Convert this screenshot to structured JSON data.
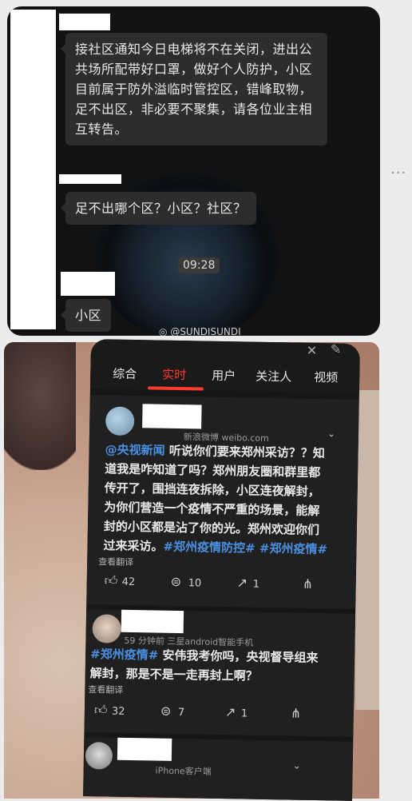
{
  "chat": {
    "message1": "接社区通知今日电梯将不在关闭，进出公共场所配带好口罩，做好个人防护，小区目前属于防外溢临时管控区，错峰取物，足不出区，非必要不聚集，请各位业主相互转告。",
    "message2": "足不出哪个区？小区？社区？",
    "timestamp": "09:28",
    "message3": "小区",
    "watermark": "@SUNDISUNDI",
    "more_icon": "···"
  },
  "weibo": {
    "tabs": [
      "综合",
      "实时",
      "用户",
      "关注人",
      "视频"
    ],
    "active_tab": "实时",
    "post1": {
      "source": "新浪微博 weibo.com",
      "mention": "@央视新闻",
      "text": " 听说你们要来郑州采访？？知道我是咋知道了吗？郑州朋友圈和群里都传开了，围挡连夜拆除，小区连夜解封，为你们营造一个疫情不严重的场景，能解封的小区都是沾了你的光。郑州欢迎你们过来采访。",
      "hashtags": "#郑州疫情防控# #郑州疫情#",
      "translate": "查看翻译",
      "likes": "42",
      "comments": "10",
      "reposts": "1"
    },
    "post2": {
      "meta": "59 分钟前   三星android智能手机",
      "hashtag": "#郑州疫情#",
      "text": " 安伟我考你吗，央视督导组来解封，那是不是一走再封上啊？",
      "translate": "查看翻译",
      "likes": "32",
      "comments": "7",
      "reposts": "1"
    },
    "post3": {
      "meta": "iPhone客户端"
    }
  }
}
